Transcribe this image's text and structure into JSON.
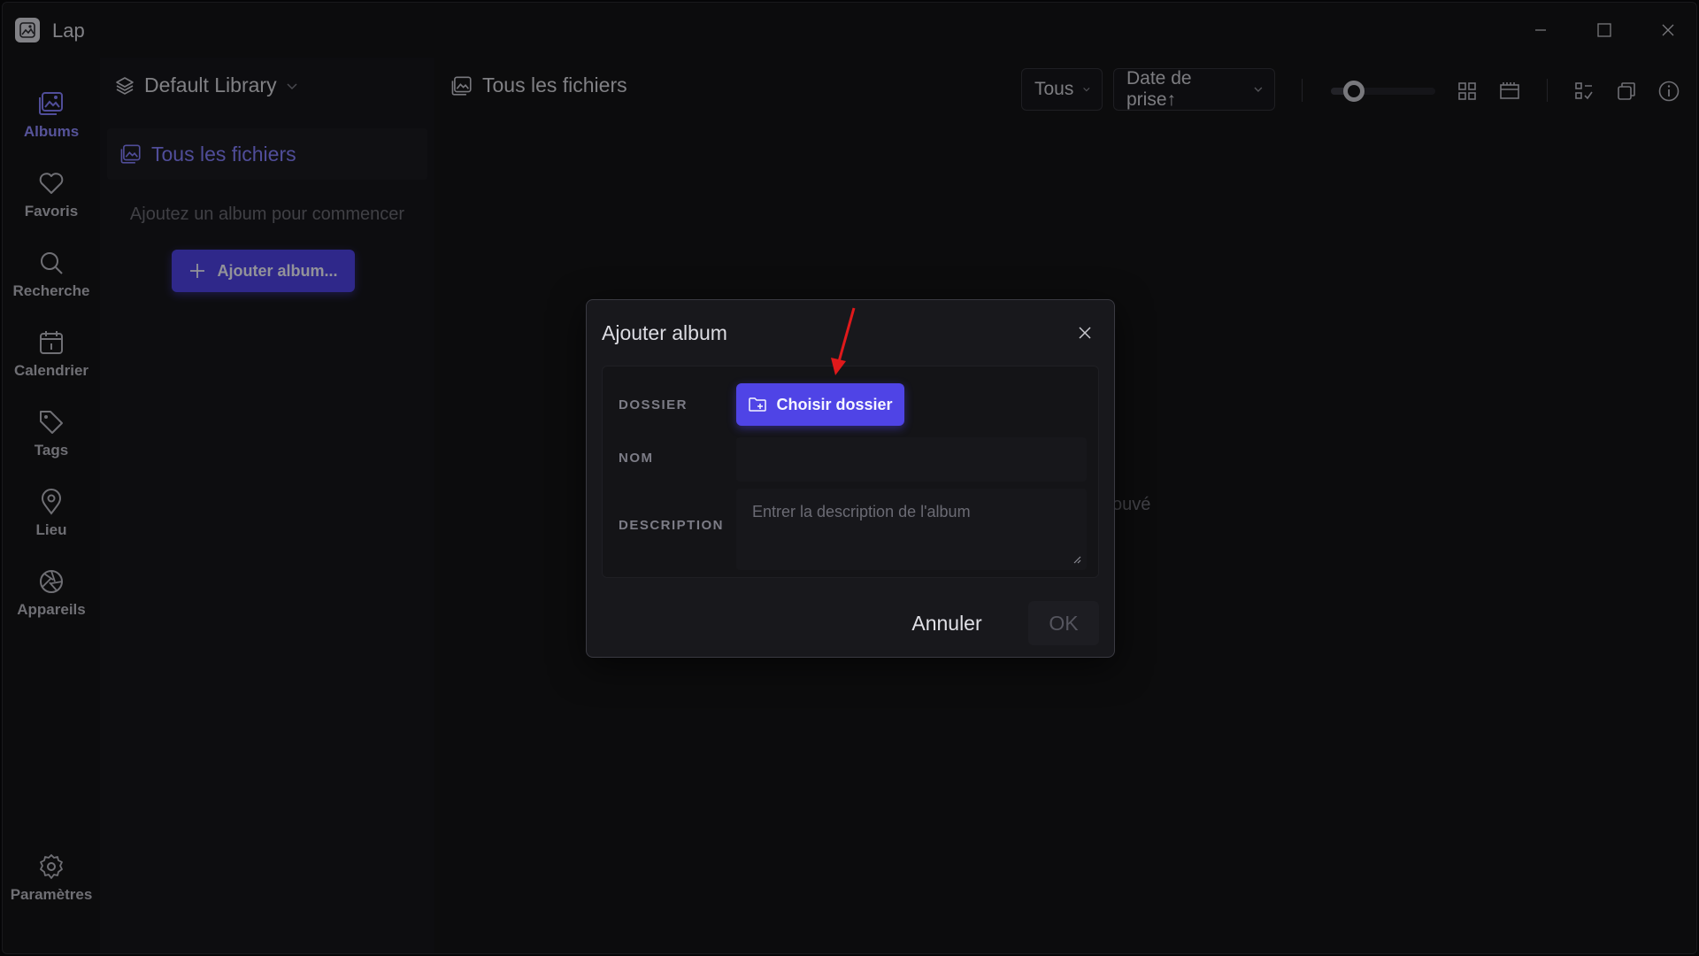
{
  "window": {
    "app_title": "Lap"
  },
  "nav": {
    "items": [
      {
        "label": "Albums",
        "icon": "albums-icon",
        "active": true
      },
      {
        "label": "Favoris",
        "icon": "heart-icon"
      },
      {
        "label": "Recherche",
        "icon": "search-icon"
      },
      {
        "label": "Calendrier",
        "icon": "calendar-icon"
      },
      {
        "label": "Tags",
        "icon": "tag-icon"
      },
      {
        "label": "Lieu",
        "icon": "location-pin-icon"
      },
      {
        "label": "Appareils",
        "icon": "aperture-icon"
      }
    ],
    "settings_label": "Paramètres"
  },
  "library": {
    "name": "Default Library",
    "all_files_label": "Tous les fichiers",
    "hint": "Ajoutez un album pour commencer",
    "add_album_label": "Ajouter album..."
  },
  "main": {
    "title": "Tous les fichiers",
    "filter_value": "Tous",
    "sort_value": "Date de prise↑",
    "empty_text": "ouvé",
    "thumbnail_size_level": 0.2
  },
  "dialog": {
    "title": "Ajouter album",
    "folder_label": "DOSSIER",
    "choose_folder_label": "Choisir dossier",
    "name_label": "NOM",
    "name_value": "",
    "description_label": "DESCRIPTION",
    "description_placeholder": "Entrer la description de l'album",
    "cancel_label": "Annuler",
    "ok_label": "OK"
  },
  "colors": {
    "accent": "#4f44e6",
    "accent_text": "#8581ff",
    "annotation_arrow": "#e0191b"
  }
}
